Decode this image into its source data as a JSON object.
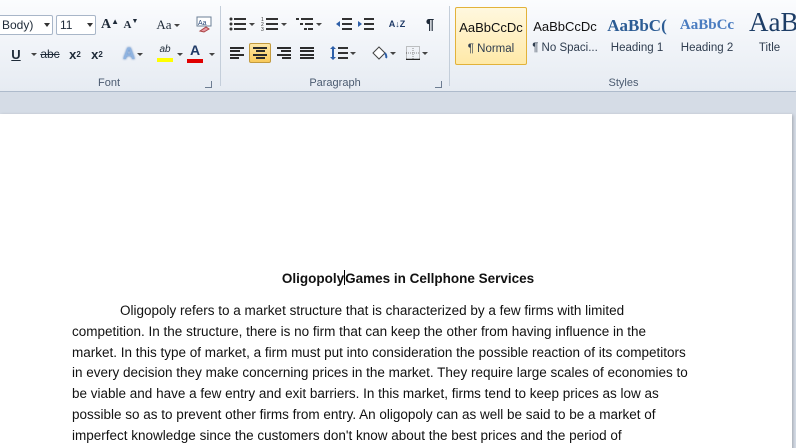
{
  "ribbon": {
    "font": {
      "font_name": "Body)",
      "font_size": "11",
      "grow_label": "A",
      "shrink_label": "A",
      "case_label": "Aa",
      "strike_label": "abc",
      "subscript_label": "x",
      "superscript_label": "x",
      "sub_mark": "2",
      "sup_mark": "2",
      "underline_label": "U",
      "effects_label": "A",
      "highlight_label": "ab",
      "color_label": "A",
      "group_label": "Font",
      "colors": {
        "highlight": "#ffff00",
        "font_color": "#e00000"
      }
    },
    "paragraph": {
      "group_label": "Paragraph",
      "show_marks": "¶",
      "sort_label": "A↓Z"
    },
    "styles": {
      "group_label": "Styles",
      "tiles": [
        {
          "sample": "AaBbCcDc",
          "name": "¶ Normal"
        },
        {
          "sample": "AaBbCcDc",
          "name": "¶ No Spaci..."
        },
        {
          "sample": "AaBbC(",
          "name": "Heading 1"
        },
        {
          "sample": "AaBbCc",
          "name": "Heading 2"
        },
        {
          "sample": "AaB",
          "name": "Title"
        }
      ]
    }
  },
  "document": {
    "title_before": "Oligopoly",
    "title_after": "Games in Cellphone Services",
    "paragraph": "Oligopoly refers to a market structure that is characterized by a few firms with limited competition. In the structure, there is no firm that can keep the other from having influence in the market. In this type of market, a firm must put into consideration the possible reaction of its competitors in every decision they make concerning prices in the market. They require large scales of economies to be viable and have a few entry and exit barriers. In this market, firms tend to keep prices as low as possible so as to prevent other firms from entry. An oligopoly can as well be said to be a market of imperfect knowledge since the customers don't know about the best prices and the period of"
  }
}
